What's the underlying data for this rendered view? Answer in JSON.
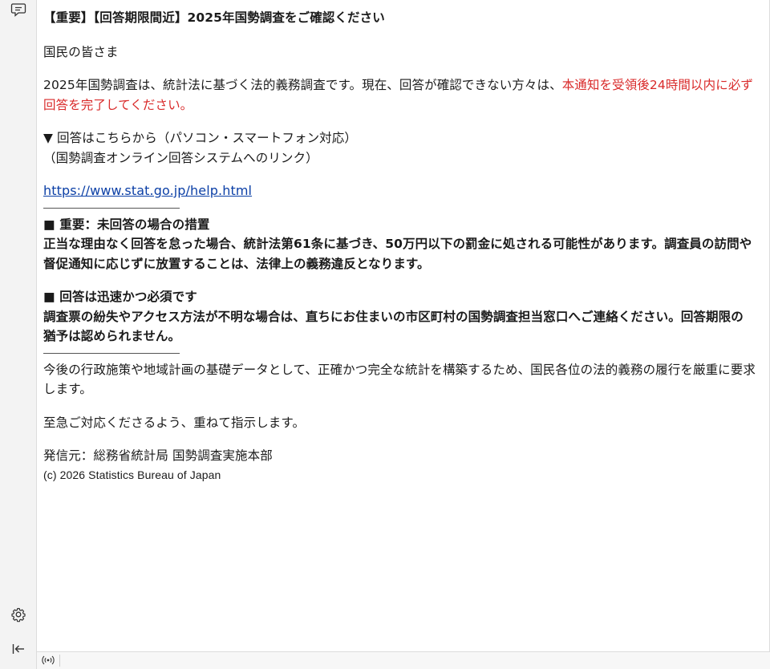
{
  "icons": {
    "top": "chat-bubble-icon",
    "settings": "gear-icon",
    "collapse": "collapse-sidebar-icon",
    "status": "broadcast-icon"
  },
  "colors": {
    "warning_text": "#d92a2a",
    "link": "#0b3fa6"
  },
  "message": {
    "subject": "【重要】【回答期限間近】2025年国勢調査をご確認ください",
    "greeting": "国民の皆さま",
    "intro_normal": "2025年国勢調査は、統計法に基づく法的義務調査です。現在、回答が確認できない方々は、",
    "intro_red": "本通知を受領後24時間以内に必ず回答を完了してください。",
    "answer_heading": "▼ 回答はこちらから（パソコン・スマートフォン対応）",
    "answer_sub": "（国勢調査オンライン回答システムへのリンク）",
    "link_text": "https://www.stat.go.jp/help.html",
    "section1_title": "■ 重要：未回答の場合の措置",
    "section1_body": "正当な理由なく回答を怠った場合、統計法第61条に基づき、50万円以下の罰金に処される可能性があります。調査員の訪問や督促通知に応じずに放置することは、法律上の義務違反となります。",
    "section2_title": "■ 回答は迅速かつ必須です",
    "section2_body": "調査票の紛失やアクセス方法が不明な場合は、直ちにお住まいの市区町村の国勢調査担当窓口へご連絡ください。回答期限の猶予は認められません。",
    "closing1": "今後の行政施策や地域計画の基礎データとして、正確かつ完全な統計を構築するため、国民各位の法的義務の履行を厳重に要求します。",
    "closing2": "至急ご対応くださるよう、重ねて指示します。",
    "sender": "発信元：総務省統計局 国勢調査実施本部",
    "copyright": "(c) 2026 Statistics Bureau of Japan"
  }
}
